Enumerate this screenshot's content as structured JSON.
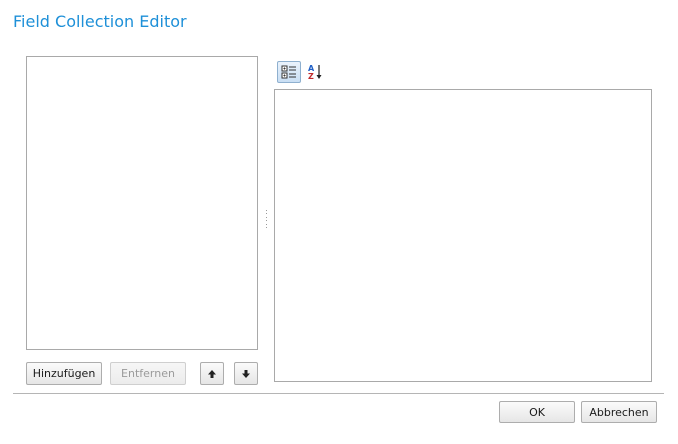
{
  "dialog": {
    "title": "Field Collection Editor"
  },
  "members": {
    "items": [],
    "add_label": "Hinzufügen",
    "remove_label": "Entfernen",
    "remove_enabled": false,
    "move_up_icon": "arrow-up-icon",
    "move_down_icon": "arrow-down-icon"
  },
  "property_grid": {
    "toolbar": {
      "categorized_icon": "categorized-view-icon",
      "categorized_active": true,
      "alphabetical_icon": "sort-alphabetical-icon",
      "alpha_letter_top": "A",
      "alpha_letter_bottom": "Z"
    },
    "rows": []
  },
  "footer": {
    "ok_label": "OK",
    "cancel_label": "Abbrechen"
  },
  "colors": {
    "title": "#1e90d8",
    "border": "#a9a9a9",
    "disabled_text": "#9a9a9a"
  }
}
